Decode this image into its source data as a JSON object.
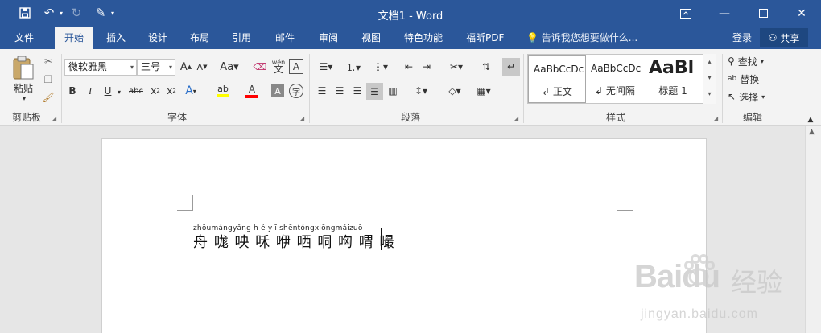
{
  "window": {
    "title": "文档1 - Word"
  },
  "qat": {
    "save": "save-icon",
    "undo": "undo-icon",
    "redo": "redo-icon",
    "touch": "touch-mode-icon",
    "customize": "▾"
  },
  "tabs": [
    "文件",
    "开始",
    "插入",
    "设计",
    "布局",
    "引用",
    "邮件",
    "审阅",
    "视图",
    "特色功能",
    "福昕PDF"
  ],
  "active_tab": "开始",
  "tellme": "告诉我您想要做什么...",
  "account": {
    "login": "登录",
    "share": "共享"
  },
  "clipboard": {
    "paste": "粘贴",
    "group": "剪贴板"
  },
  "font": {
    "name": "微软雅黑",
    "size": "三号",
    "group": "字体"
  },
  "paragraph": {
    "group": "段落"
  },
  "styles": {
    "group": "样式",
    "items": [
      {
        "preview": "AaBbCcDc",
        "name": "正文"
      },
      {
        "preview": "AaBbCcDc",
        "name": "无间隔"
      },
      {
        "preview": "AaBl",
        "name": "标题 1"
      }
    ]
  },
  "editing": {
    "find": "查找",
    "replace": "替换",
    "select": "选择",
    "group": "编辑"
  },
  "document": {
    "pinyin": "zhōumángyǎng h é y ī shēntóngxiōngmǎizuō",
    "text": "舟 哤 咉 咊 咿 哂 哃 哅 喟 嘬"
  },
  "watermark": {
    "brand": "Baidu",
    "cn": "经验",
    "url": "jingyan.baidu.com"
  },
  "colors": {
    "titlebar": "#2b579a",
    "ribbon": "#f3f3f3",
    "highlight": "#ffff00",
    "font_color": "#ff0000"
  }
}
